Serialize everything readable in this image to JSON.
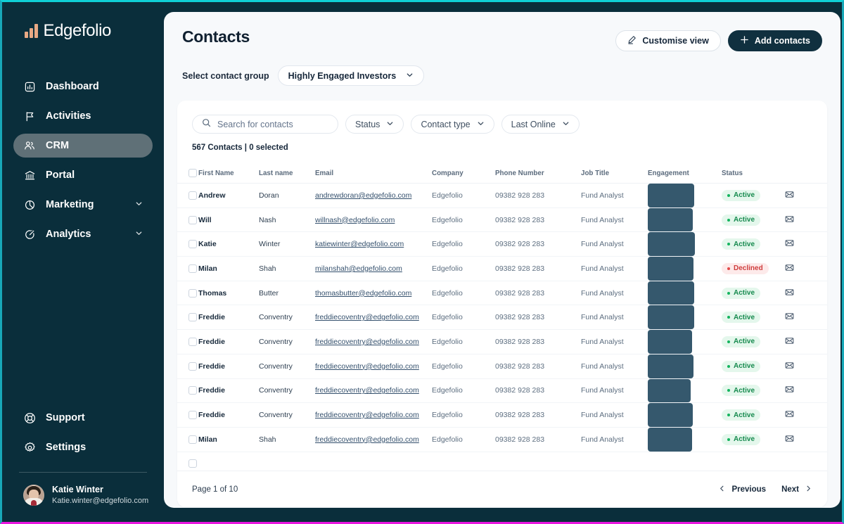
{
  "brand": {
    "name": "Edgefolio",
    "logo_icon": "bar-chart-logo-icon",
    "accent": "#e8a984",
    "sidebar_bg": "#0a2e3b"
  },
  "sidebar": {
    "items": [
      {
        "label": "Dashboard",
        "icon": "dashboard-icon",
        "active": false,
        "expandable": false
      },
      {
        "label": "Activities",
        "icon": "flag-icon",
        "active": false,
        "expandable": false
      },
      {
        "label": "CRM",
        "icon": "users-icon",
        "active": true,
        "expandable": false
      },
      {
        "label": "Portal",
        "icon": "bank-icon",
        "active": false,
        "expandable": false
      },
      {
        "label": "Marketing",
        "icon": "pie-chart-icon",
        "active": false,
        "expandable": true
      },
      {
        "label": "Analytics",
        "icon": "analytics-icon",
        "active": false,
        "expandable": true
      }
    ],
    "bottom_items": [
      {
        "label": "Support",
        "icon": "lifebuoy-icon"
      },
      {
        "label": "Settings",
        "icon": "gear-icon"
      }
    ],
    "user": {
      "name": "Katie Winter",
      "email": "Katie.winter@edgefolio.com",
      "avatar": "user-avatar"
    }
  },
  "header": {
    "title": "Contacts",
    "customise_view_label": "Customise view",
    "customise_view_icon": "pencil-icon",
    "add_contacts_label": "Add contacts",
    "add_contacts_icon": "plus-icon"
  },
  "group": {
    "label": "Select contact group",
    "selected": "Highly Engaged Investors",
    "chevron_icon": "chevron-down-icon"
  },
  "filters": {
    "search_placeholder": "Search for contacts",
    "search_value": "",
    "search_icon": "search-icon",
    "chips": [
      {
        "label": "Status",
        "icon": "chevron-down-icon"
      },
      {
        "label": "Contact type",
        "icon": "chevron-down-icon"
      },
      {
        "label": "Last Online",
        "icon": "chevron-down-icon"
      }
    ],
    "count_text": "567 Contacts | 0 selected"
  },
  "table": {
    "select_all_icon": "checkbox-icon",
    "columns": [
      "First Name",
      "Last name",
      "Email",
      "Company",
      "Phone Number",
      "Job Title",
      "Engagement",
      "Status"
    ],
    "row_action_icon": "envelope-icon",
    "rows": [
      {
        "first_name": "Andrew",
        "last_name": "Doran",
        "email": "andrewdoran@edgefolio.com",
        "company": "Edgefolio",
        "phone": "09382 928 283",
        "job_title": "Fund Analyst",
        "engagement": 63,
        "status": "Active"
      },
      {
        "first_name": "Will",
        "last_name": "Nash",
        "email": "willnash@edgefolio.com",
        "company": "Edgefolio",
        "phone": "09382 928 283",
        "job_title": "Fund Analyst",
        "engagement": 61,
        "status": "Active"
      },
      {
        "first_name": "Katie",
        "last_name": "Winter",
        "email": "katiewinter@edgefolio.com",
        "company": "Edgefolio",
        "phone": "09382 928 283",
        "job_title": "Fund Analyst",
        "engagement": 64,
        "status": "Active"
      },
      {
        "first_name": "Milan",
        "last_name": "Shah",
        "email": "milanshah@edgefolio.com",
        "company": "Edgefolio",
        "phone": "09382 928 283",
        "job_title": "Fund Analyst",
        "engagement": 62,
        "status": "Declined"
      },
      {
        "first_name": "Thomas",
        "last_name": "Butter",
        "email": "thomasbutter@edgefolio.com",
        "company": "Edgefolio",
        "phone": "09382 928 283",
        "job_title": "Fund Analyst",
        "engagement": 63,
        "status": "Active"
      },
      {
        "first_name": "Freddie",
        "last_name": "Conventry",
        "email": "freddiecoventry@edgefolio.com",
        "company": "Edgefolio",
        "phone": "09382 928 283",
        "job_title": "Fund Analyst",
        "engagement": 63,
        "status": "Active"
      },
      {
        "first_name": "Freddie",
        "last_name": "Conventry",
        "email": "freddiecoventry@edgefolio.com",
        "company": "Edgefolio",
        "phone": "09382 928 283",
        "job_title": "Fund Analyst",
        "engagement": 60,
        "status": "Active"
      },
      {
        "first_name": "Freddie",
        "last_name": "Conventry",
        "email": "freddiecoventry@edgefolio.com",
        "company": "Edgefolio",
        "phone": "09382 928 283",
        "job_title": "Fund Analyst",
        "engagement": 62,
        "status": "Active"
      },
      {
        "first_name": "Freddie",
        "last_name": "Conventry",
        "email": "freddiecoventry@edgefolio.com",
        "company": "Edgefolio",
        "phone": "09382 928 283",
        "job_title": "Fund Analyst",
        "engagement": 58,
        "status": "Active"
      },
      {
        "first_name": "Freddie",
        "last_name": "Conventry",
        "email": "freddiecoventry@edgefolio.com",
        "company": "Edgefolio",
        "phone": "09382 928 283",
        "job_title": "Fund Analyst",
        "engagement": 61,
        "status": "Active"
      },
      {
        "first_name": "Milan",
        "last_name": "Shah",
        "email": "freddiecoventry@edgefolio.com",
        "company": "Edgefolio",
        "phone": "09382 928 283",
        "job_title": "Fund Analyst",
        "engagement": 60,
        "status": "Active"
      }
    ]
  },
  "footer": {
    "page_indicator": "Page 1 of 10",
    "previous_label": "Previous",
    "next_label": "Next",
    "prev_icon": "chevron-left-icon",
    "next_icon": "chevron-right-icon"
  }
}
